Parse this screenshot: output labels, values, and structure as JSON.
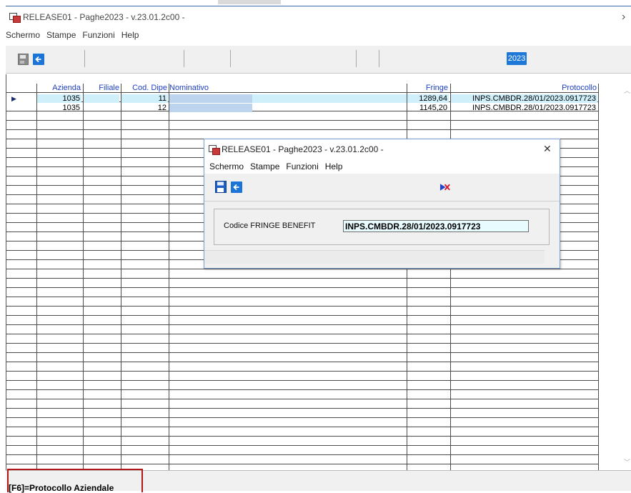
{
  "main_window": {
    "title": "RELEASE01 - Paghe2023 - v.23.01.2c00 -",
    "close_glyph": "›",
    "menu": [
      "Schermo",
      "Stampe",
      "Funzioni",
      "Help"
    ],
    "toolbar": {
      "save_icon": "save-disabled-icon",
      "back_icon": "back-arrow-icon",
      "year": "2023"
    }
  },
  "grid": {
    "columns": [
      "Azienda",
      "Filiale",
      "Cod. Dipe",
      "Nominativo",
      "Fringe",
      "Protocollo"
    ],
    "rows": [
      {
        "azienda": "1035",
        "filiale": "",
        "cod_dipe": "11",
        "nominativo": "",
        "fringe": "1289,64",
        "protocollo": "INPS.CMBDR.28/01/2023.0917723"
      },
      {
        "azienda": "1035",
        "filiale": "",
        "cod_dipe": "12",
        "nominativo": "",
        "fringe": "1145,20",
        "protocollo": "INPS.CMBDR.28/01/2023.0917723"
      }
    ],
    "row_indicator": "▶",
    "highlight_color": "#cfeffa",
    "redacted_color": "#bcd4ee"
  },
  "status_bar": {
    "text": "[F6]=Protocollo Aziendale"
  },
  "dialog": {
    "title": "RELEASE01 - Paghe2023 - v.23.01.2c00 -",
    "close_glyph": "✕",
    "menu": [
      "Schermo",
      "Stampe",
      "Funzioni",
      "Help"
    ],
    "field_label": "Codice FRINGE BENEFIT",
    "field_value": "INPS.CMBDR.28/01/2023.0917723"
  }
}
